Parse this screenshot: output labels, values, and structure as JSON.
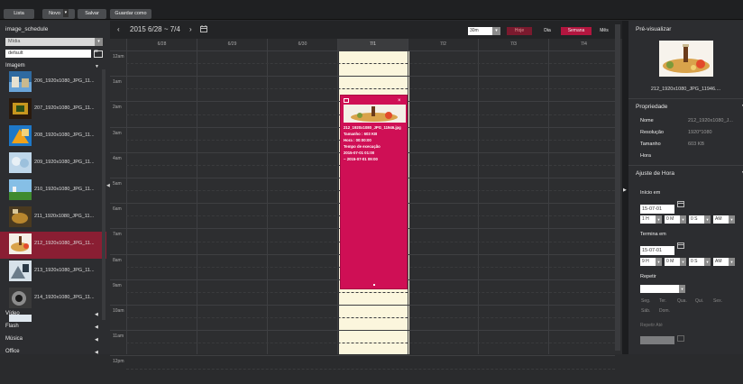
{
  "toolbar": {
    "list_label": "Lista",
    "new_label": "Novo",
    "save_label": "Salvar",
    "save_as_label": "Guardar como"
  },
  "left": {
    "title": "image_schedule",
    "type_select": "Mídia",
    "name_input": "default",
    "category_image": "Imagem",
    "items": [
      {
        "label": "206_1920x1080_JPG_11..."
      },
      {
        "label": "207_1920x1080_JPG_11..."
      },
      {
        "label": "208_1920x1080_JPG_11..."
      },
      {
        "label": "209_1920x1080_JPG_11..."
      },
      {
        "label": "210_1920x1080_JPG_11..."
      },
      {
        "label": "211_1920x1080_JPG_11..."
      },
      {
        "label": "212_1920x1080_JPG_11..."
      },
      {
        "label": "213_1920x1080_JPG_11..."
      },
      {
        "label": "214_1920x1080_JPG_11..."
      }
    ],
    "categories": [
      "Vídeo",
      "Flash",
      "Música",
      "Office"
    ]
  },
  "calendar": {
    "prev": "‹",
    "next": "›",
    "range": "2015 6/28 ~ 7/4",
    "zoom": "30m",
    "today_btn": "Hoje",
    "views": [
      "Dia",
      "Semana",
      "Mês"
    ],
    "days": [
      "6/28",
      "6/29",
      "6/30",
      "7/1",
      "7/2",
      "7/3",
      "7/4"
    ],
    "hours": [
      "12am",
      "1am",
      "2am",
      "3am",
      "4am",
      "5am",
      "6am",
      "7am",
      "8am",
      "9am",
      "10am",
      "11am",
      "12pm"
    ]
  },
  "event": {
    "title": "212_1920x1080_JPG_11946.jpg",
    "size": "Tamanho : 603 KB",
    "hour": "Hora : 00:00:00",
    "exec_label": "Tempo de execução",
    "start": "2015-07-01 01:00",
    "end": "~ 2015-07-01 09:00"
  },
  "right": {
    "preview_title": "Pré-visualizar",
    "preview_caption": "212_1920x1080_JPG_11946....",
    "props_title": "Propriedade",
    "props": [
      {
        "k": "Nome",
        "v": "212_1920x1080_J..."
      },
      {
        "k": "Resolução",
        "v": "1920*1080"
      },
      {
        "k": "Tamanho",
        "v": "603 KB"
      },
      {
        "k": "Hora",
        "v": ""
      }
    ],
    "adjust_title": "Ajuste de Hora",
    "start_label": "Início em",
    "start_date": "15-07-01",
    "start_h": "1 H",
    "start_m": "0 M",
    "start_s": "0 S",
    "start_ampm": "AM",
    "end_label": "Termina em",
    "end_date": "15-07-01",
    "end_h": "9 H",
    "end_m": "0 M",
    "end_s": "0 S",
    "end_ampm": "AM",
    "repeat_label": "Repetir",
    "weekdays": [
      "Seg.",
      "Ter.",
      "Qua.",
      "Qui.",
      "Sex.",
      "Sáb.",
      "Dom."
    ],
    "repeat_until": "Repetir Até"
  }
}
